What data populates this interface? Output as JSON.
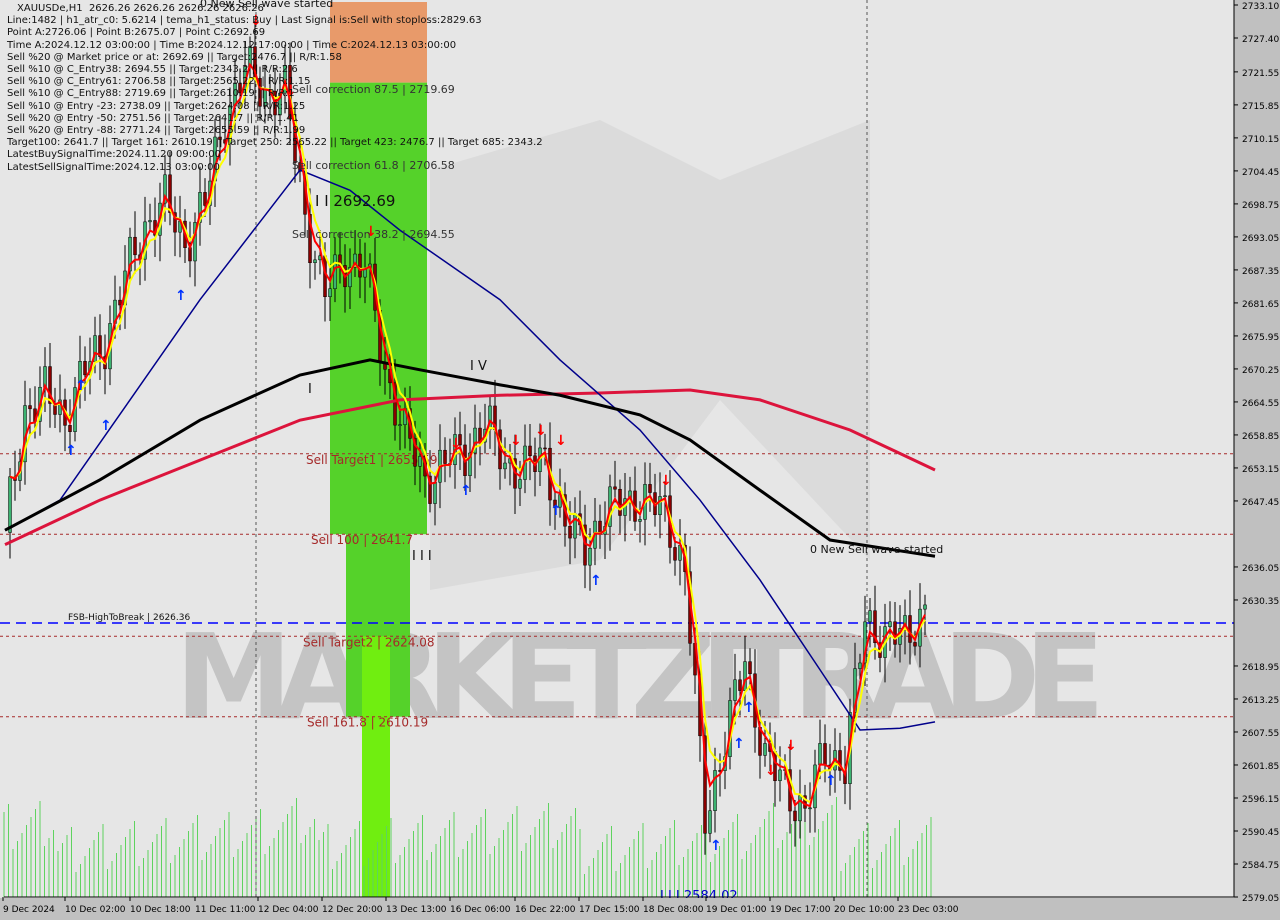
{
  "header": {
    "symbol_line": "XAUUSDe,H1  2626.26 2626.26 2626.26 2626.26",
    "info_lines": [
      "Line:1482 | h1_atr_c0: 5.6214 | tema_h1_status: Buy | Last Signal is:Sell with stoploss:2829.63",
      "Point A:2726.06 | Point B:2675.07 | Point C:2692.69",
      "Time A:2024.12.12 03:00:00 | Time B:2024.12.12 17:00:00 | Time C:2024.12.13 03:00:00",
      "Sell %20 @ Market price or at: 2692.69 || Target:2476.7 || R/R:1.58",
      "Sell %10 @ C_Entry38: 2694.55 || Target:2343.2 || R/R:2.6",
      "Sell %10 @ C_Entry61: 2706.58 || Target:2565.22 || R/R:1.15",
      "Sell %10 @ C_Entry88: 2719.69 || Target:2610.19 || R/R:1",
      "Sell %10 @ Entry -23: 2738.09 || Target:2624.08 || R/R:1.25",
      "Sell %20 @ Entry -50: 2751.56 || Target:2641.7 || R/R:1.41",
      "Sell %20 @ Entry -88: 2771.24 || Target:2655.59 || R/R:1.99",
      "Target100: 2641.7 || Target 161: 2610.19 || Target 250: 2565.22 || Target 423: 2476.7 || Target 685: 2343.2",
      "LatestBuySignalTime:2024.11.20 09:00:00",
      "LatestSellSignalTime:2024.12.13 03:00:00"
    ]
  },
  "watermark": "MARKETZITRADE",
  "colors": {
    "background": "#e6e6e6",
    "bull": "#3cb371",
    "bear": "#8b0000",
    "sma_slow": "#000000",
    "sma_mid": "#dc143c",
    "ma_blue": "#00008b",
    "fast_red": "#ff0000",
    "fast_yellow": "#ffff00",
    "level": "#a52a2a",
    "fsb": "#0000ff",
    "zone_orange": "#e89a6a",
    "zone_green": "#55d22a",
    "zone_lime": "#70ee10"
  },
  "chart_data": {
    "type": "candlestick",
    "ylim": [
      2579.05,
      2733.1
    ],
    "y_ticks": [
      "2733.10",
      "2727.40",
      "2721.55",
      "2715.85",
      "2710.15",
      "2704.45",
      "2698.75",
      "2693.05",
      "2687.35",
      "2681.65",
      "2675.95",
      "2670.25",
      "2664.55",
      "2658.85",
      "2653.15",
      "2647.45",
      "2641.70",
      "2636.05",
      "2630.35",
      "2626.36",
      "2624.08",
      "2618.95",
      "2613.25",
      "2607.55",
      "2601.85",
      "2596.15",
      "2590.45",
      "2584.75",
      "2579.05"
    ],
    "x_ticks": [
      "9 Dec 2024",
      "10 Dec 02:00",
      "10 Dec 18:00",
      "11 Dec 11:00",
      "12 Dec 04:00",
      "12 Dec 20:00",
      "13 Dec 13:00",
      "16 Dec 06:00",
      "16 Dec 22:00",
      "17 Dec 15:00",
      "18 Dec 08:00",
      "19 Dec 01:00",
      "19 Dec 17:00",
      "20 Dec 10:00",
      "23 Dec 03:00"
    ],
    "closes": [
      2642,
      2663,
      2666,
      2662,
      2670,
      2675,
      2686,
      2695,
      2699,
      2692,
      2699,
      2714,
      2722,
      2718,
      2718,
      2697,
      2683,
      2689,
      2688,
      2670,
      2659,
      2651,
      2654,
      2656,
      2661,
      2654,
      2653,
      2655,
      2643,
      2640,
      2645,
      2648,
      2647,
      2646,
      2635,
      2593,
      2606,
      2620,
      2603,
      2598,
      2594,
      2604,
      2602,
      2627,
      2624,
      2624,
      2629
    ],
    "ma_slow": [
      [
        0,
        2642.4
      ],
      [
        4.75,
        2651.1
      ],
      [
        9.75,
        2661.4
      ],
      [
        14.75,
        2669.2
      ],
      [
        18.25,
        2671.8
      ],
      [
        20.75,
        2670.1
      ],
      [
        24.75,
        2667.5
      ],
      [
        27.75,
        2665.7
      ],
      [
        31.75,
        2662.3
      ],
      [
        34.25,
        2658.0
      ],
      [
        37.75,
        2649.3
      ],
      [
        41.25,
        2640.7
      ],
      [
        46.5,
        2637.9
      ]
    ],
    "ma_mid": [
      [
        0,
        2639.9
      ],
      [
        4.75,
        2647.6
      ],
      [
        9.75,
        2654.5
      ],
      [
        14.75,
        2661.4
      ],
      [
        19.75,
        2664.9
      ],
      [
        24.75,
        2665.7
      ],
      [
        29.75,
        2666.1
      ],
      [
        34.25,
        2666.6
      ],
      [
        37.75,
        2664.9
      ],
      [
        42.25,
        2659.7
      ],
      [
        46.5,
        2652.8
      ]
    ],
    "ma_blue": [
      [
        0,
        2642.4
      ],
      [
        2.75,
        2647.6
      ],
      [
        6.25,
        2664.9
      ],
      [
        9.75,
        2682.2
      ],
      [
        14.75,
        2704.6
      ],
      [
        17.25,
        2701.1
      ],
      [
        19.75,
        2694.2
      ],
      [
        24.75,
        2682.2
      ],
      [
        27.75,
        2671.8
      ],
      [
        31.75,
        2659.7
      ],
      [
        34.75,
        2647.6
      ],
      [
        37.75,
        2633.8
      ],
      [
        40.75,
        2618.3
      ],
      [
        42.75,
        2607.9
      ],
      [
        44.75,
        2608.2
      ],
      [
        46.5,
        2609.3
      ]
    ],
    "levels": [
      {
        "label": "Sell Target1 | 2655.59",
        "tag": "2655.59",
        "price": 2655.59
      },
      {
        "label": "Sell 100 | 2641.7",
        "tag": "2641.70",
        "price": 2641.7
      },
      {
        "label": "Sell Target2 | 2624.08",
        "tag": "2624.08",
        "price": 2624.08
      },
      {
        "label": "Sell 161.8 | 2610.19",
        "tag": "2610.19",
        "price": 2610.19
      }
    ],
    "fsb": {
      "label": "FSB-HighToBreak | 2626.36",
      "tag": "2626.36",
      "price": 2626.36
    },
    "zones": [
      {
        "label": "Sell correction 87.5 | 2719.69",
        "price": 2719.69
      },
      {
        "label": "Sell correction 61.8 | 2706.58",
        "price": 2706.58
      },
      {
        "label": "Sell correction 38.2 | 2694.55",
        "price": 2694.55
      }
    ],
    "annotations": {
      "wave_top": "0 New Sell wave started",
      "wave_right": "0 New Sell wave started",
      "point_c": "I I 2692.69",
      "iv": "I V",
      "i": "I",
      "iii": "I I I",
      "low": "I I I 2584.02"
    }
  }
}
